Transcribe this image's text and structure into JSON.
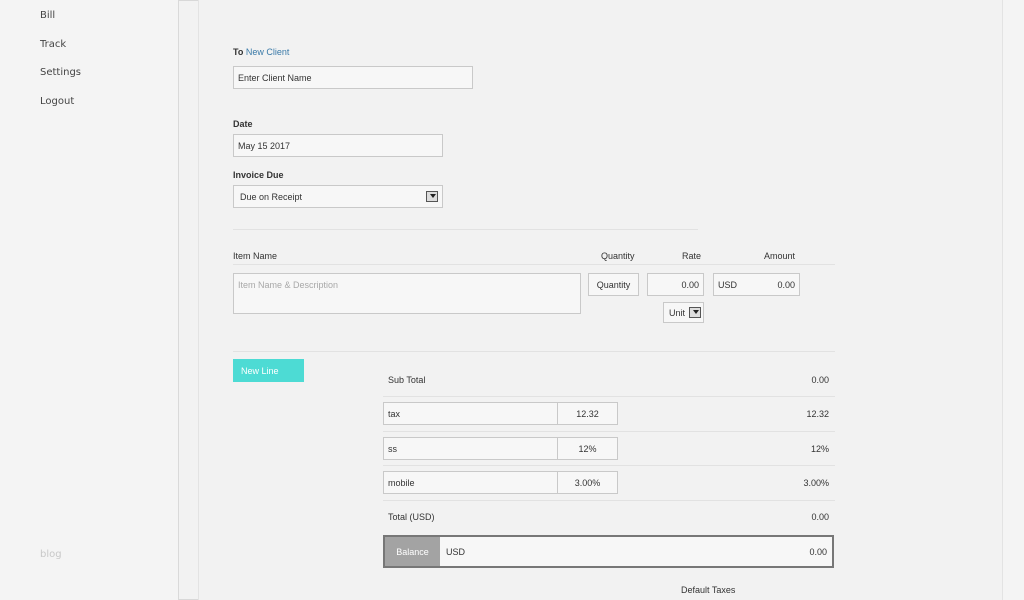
{
  "sidebar": {
    "items": [
      {
        "label": "Bill"
      },
      {
        "label": "Track"
      },
      {
        "label": "Settings"
      },
      {
        "label": "Logout"
      }
    ],
    "footer_link": "blog"
  },
  "client": {
    "to_label": "To",
    "new_client_link": "New Client",
    "placeholder": "Enter Client Name"
  },
  "date": {
    "label": "Date",
    "value": "May 15 2017"
  },
  "invoice_due": {
    "label": "Invoice Due",
    "selected": "Due on Receipt"
  },
  "items_table": {
    "headers": {
      "item_name": "Item Name",
      "quantity": "Quantity",
      "rate": "Rate",
      "amount": "Amount"
    },
    "row": {
      "description_placeholder": "Item Name & Description",
      "quantity_placeholder": "Quantity",
      "rate": "0.00",
      "currency": "USD",
      "amount": "0.00",
      "unit_selected": "Unit"
    }
  },
  "new_line_button": "New Line",
  "totals": {
    "subtotal_label": "Sub Total",
    "subtotal_value": "0.00",
    "taxes": [
      {
        "name": "tax",
        "rate": "12.32",
        "amount": "12.32"
      },
      {
        "name": "ss",
        "rate": "12%",
        "amount": "12%"
      },
      {
        "name": "mobile",
        "rate": "3.00%",
        "amount": "3.00%"
      }
    ],
    "total_label": "Total (USD)",
    "total_value": "0.00",
    "balance_label": "Balance",
    "balance_currency": "USD",
    "balance_value": "0.00"
  },
  "default_taxes_link": "Default Taxes",
  "colors": {
    "accent": "#4ddbd4",
    "link": "#3a7aa8",
    "balance_label_bg": "#a3a3a3"
  }
}
